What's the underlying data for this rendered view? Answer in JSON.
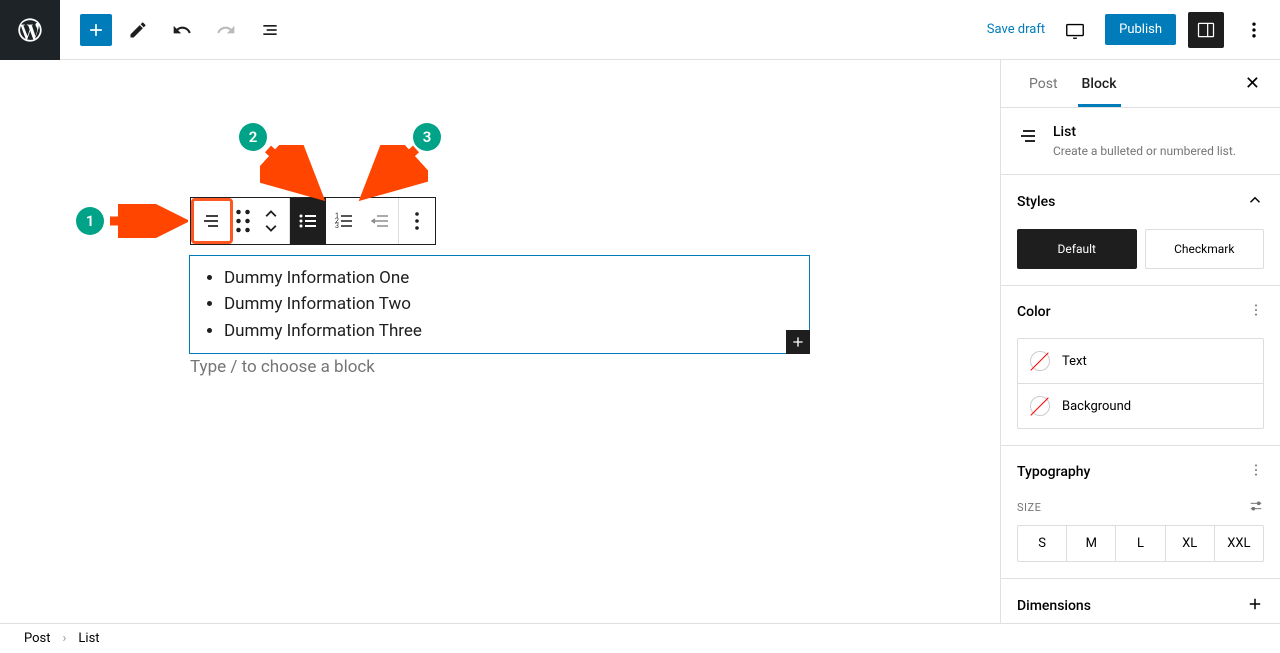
{
  "header": {
    "save_draft": "Save draft",
    "publish": "Publish"
  },
  "annotations": {
    "badge1": "1",
    "badge2": "2",
    "badge3": "3"
  },
  "list_block": {
    "items": [
      "Dummy Information One",
      "Dummy Information Two",
      "Dummy Information Three"
    ]
  },
  "placeholder": "Type / to choose a block",
  "sidebar": {
    "tabs": {
      "post": "Post",
      "block": "Block"
    },
    "block_card": {
      "title": "List",
      "description": "Create a bulleted or numbered list."
    },
    "styles": {
      "title": "Styles",
      "default": "Default",
      "checkmark": "Checkmark"
    },
    "color": {
      "title": "Color",
      "text": "Text",
      "background": "Background"
    },
    "typography": {
      "title": "Typography",
      "size_label": "SIZE",
      "sizes": [
        "S",
        "M",
        "L",
        "XL",
        "XXL"
      ]
    },
    "dimensions": {
      "title": "Dimensions"
    }
  },
  "breadcrumb": {
    "post": "Post",
    "list": "List"
  }
}
